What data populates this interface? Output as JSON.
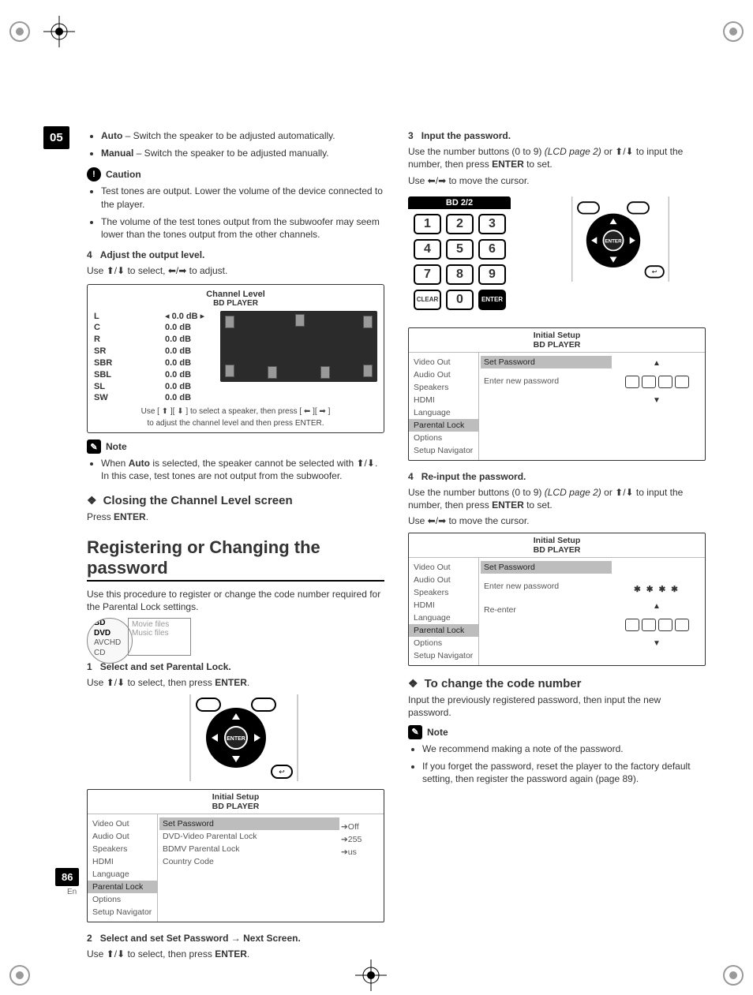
{
  "chapter": "05",
  "pageNumber": "86",
  "lang": "En",
  "left": {
    "bullets_top": [
      {
        "label": "Auto",
        "text": " – Switch the speaker to be adjusted automatically."
      },
      {
        "label": "Manual",
        "text": " – Switch the speaker to be adjusted manually."
      }
    ],
    "caution_label": "Caution",
    "caution_items": [
      "Test tones are output. Lower the volume of the device connected to the player.",
      "The volume of the test tones output from the subwoofer may seem lower than the tones output from the other channels."
    ],
    "step4_num": "4",
    "step4_title": "Adjust the output level.",
    "step4_text_a": "Use ",
    "step4_text_b": " to select, ",
    "step4_text_c": " to adjust.",
    "channel_panel": {
      "title": "Channel Level",
      "subtitle": "BD PLAYER",
      "rows": [
        {
          "ch": "L",
          "val": "0.0 dB",
          "sel": true
        },
        {
          "ch": "C",
          "val": "0.0 dB"
        },
        {
          "ch": "R",
          "val": "0.0 dB"
        },
        {
          "ch": "SR",
          "val": "0.0 dB"
        },
        {
          "ch": "SBR",
          "val": "0.0 dB"
        },
        {
          "ch": "SBL",
          "val": "0.0 dB"
        },
        {
          "ch": "SL",
          "val": "0.0 dB"
        },
        {
          "ch": "SW",
          "val": "0.0 dB"
        }
      ],
      "foot1": "Use [ ⬆ ][ ⬇ ] to select a speaker, then press [ ⬅ ][ ➡ ]",
      "foot2": "to adjust the channel level and then press ENTER."
    },
    "note_label": "Note",
    "note_items": [
      {
        "pre": "When ",
        "bold": "Auto",
        "post": " is selected, the speaker cannot be selected with ⬆/⬇. In this case, test tones are not output from the subwoofer."
      }
    ],
    "closing_heading": "Closing the Channel Level screen",
    "closing_text_a": "Press ",
    "closing_text_b": "ENTER",
    "closing_text_c": ".",
    "h1": "Registering or Changing the password",
    "h1_para": "Use this procedure to register or change the code number required for the Parental Lock settings.",
    "disc": {
      "l1": "BD",
      "l2": "DVD",
      "l3": "AVCHD",
      "l4": "CD",
      "f1": "Movie files",
      "f2": "Music files"
    },
    "step1_num": "1",
    "step1_title": "Select and set Parental Lock.",
    "step1_text_a": "Use ⬆/⬇ to select, then press ",
    "step1_text_b": "ENTER",
    "step1_text_c": ".",
    "setup1": {
      "title": "Initial Setup",
      "sub": "BD PLAYER",
      "left": [
        "Video Out",
        "Audio Out",
        "Speakers",
        "HDMI",
        "Language",
        "Parental Lock",
        "Options",
        "Setup Navigator"
      ],
      "selected": "Parental Lock",
      "mid": [
        "Set Password",
        "DVD-Video Parental Lock",
        "BDMV Parental Lock",
        "Country Code"
      ],
      "midSelected": "Set Password",
      "vals": [
        "",
        "➔Off",
        "➔255",
        "➔us"
      ]
    },
    "step2_num": "2",
    "step2_title": "Select and set Set Password → Next Screen.",
    "step2_text_a": "Use ⬆/⬇ to select, then press ",
    "step2_text_b": "ENTER",
    "step2_text_c": "."
  },
  "right": {
    "step3_num": "3",
    "step3_title": "Input the password.",
    "step3_text1_a": "Use the number buttons (0 to 9) ",
    "step3_text1_b": "(LCD page 2)",
    "step3_text1_c": " or ⬆/⬇ to input the number, then press ",
    "step3_text1_d": "ENTER",
    "step3_text1_e": " to set.",
    "step3_text2": "Use ⬅/➡ to move the cursor.",
    "keypad": {
      "head": "BD   2/2",
      "keys": [
        "1",
        "2",
        "3",
        "4",
        "5",
        "6",
        "7",
        "8",
        "9",
        "CLEAR",
        "0",
        "ENTER"
      ]
    },
    "setup2": {
      "title": "Initial Setup",
      "sub": "BD PLAYER",
      "left": [
        "Video Out",
        "Audio Out",
        "Speakers",
        "HDMI",
        "Language",
        "Parental Lock",
        "Options",
        "Setup Navigator"
      ],
      "selected": "Parental Lock",
      "mid1": "Set Password",
      "mid2": "Enter new password"
    },
    "step4_num": "4",
    "step4_title": "Re-input the password.",
    "step4_text1_a": "Use the number buttons (0 to 9) ",
    "step4_text1_b": "(LCD page 2)",
    "step4_text1_c": " or ⬆/⬇ to input the number, then press ",
    "step4_text1_d": "ENTER",
    "step4_text1_e": " to set.",
    "step4_text2": "Use ⬅/➡ to move the cursor.",
    "setup3": {
      "title": "Initial Setup",
      "sub": "BD PLAYER",
      "left": [
        "Video Out",
        "Audio Out",
        "Speakers",
        "HDMI",
        "Language",
        "Parental Lock",
        "Options",
        "Setup Navigator"
      ],
      "selected": "Parental Lock",
      "mid1": "Set Password",
      "mid2": "Enter new password",
      "mid3": "Re-enter",
      "stars": "✱  ✱  ✱  ✱"
    },
    "change_heading": "To change the code number",
    "change_para": "Input the previously registered password, then input the new password.",
    "note_label": "Note",
    "note_items": [
      "We recommend making a note of the password.",
      "If you forget the password, reset the player to the factory default setting, then register the password again (page 89)."
    ]
  }
}
